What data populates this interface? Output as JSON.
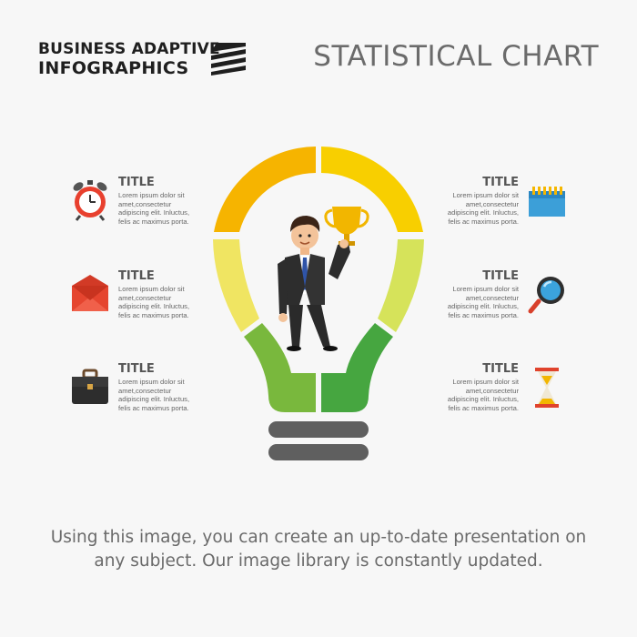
{
  "brand": {
    "line1": "BUSINESS ADAPTIVE",
    "line2": "INFOGRAPHICS"
  },
  "title": "STATISTICAL CHART",
  "items": [
    {
      "title": "TITLE",
      "text": "Lorem ipsum dolor sit amet,consectetur adipiscing elit. Inluctus, felis ac maximus porta.",
      "icon": "alarm-clock-icon",
      "side": "left"
    },
    {
      "title": "TITLE",
      "text": "Lorem ipsum dolor sit amet,consectetur adipiscing elit. Inluctus, felis ac maximus porta.",
      "icon": "envelope-icon",
      "side": "left"
    },
    {
      "title": "TITLE",
      "text": "Lorem ipsum dolor sit amet,consectetur adipiscing elit. Inluctus, felis ac maximus porta.",
      "icon": "briefcase-icon",
      "side": "left"
    },
    {
      "title": "TITLE",
      "text": "Lorem ipsum dolor sit amet,consectetur adipiscing elit. Inluctus, felis ac maximus porta.",
      "icon": "calendar-icon",
      "side": "right"
    },
    {
      "title": "TITLE",
      "text": "Lorem ipsum dolor sit amet,consectetur adipiscing elit. Inluctus, felis ac maximus porta.",
      "icon": "magnifier-icon",
      "side": "right"
    },
    {
      "title": "TITLE",
      "text": "Lorem ipsum dolor sit amet,consectetur adipiscing elit. Inluctus, felis ac maximus porta.",
      "icon": "hourglass-icon",
      "side": "right"
    }
  ],
  "caption": {
    "line1": "Using this image, you can create an up-to-date presentation on",
    "line2": "any subject. Our image library is constantly updated."
  },
  "colors": {
    "bulb_top": "#f6b400",
    "bulb_top_light": "#f8cf00",
    "bulb_mid": "#f0e562",
    "bulb_mid_right": "#d6e35a",
    "bulb_bottom": "#79b83d",
    "bulb_bottom_dark": "#46a640",
    "base": "#5f5f5f"
  }
}
